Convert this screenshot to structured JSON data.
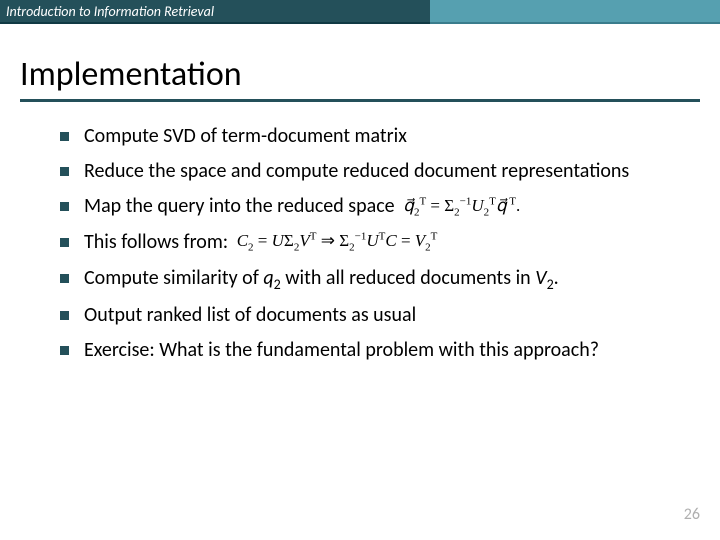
{
  "header": {
    "label": "Introduction to Information Retrieval"
  },
  "title": "Implementation",
  "bullets": [
    {
      "text": "Compute SVD of term-document matrix"
    },
    {
      "text": "Reduce the space and compute reduced document representations"
    },
    {
      "text": "Map the query into the reduced space",
      "math_suffix": "q2_formula"
    },
    {
      "text": "This follows from:",
      "math_suffix": "follows_formula"
    },
    {
      "text_html": "compute_sim"
    },
    {
      "text": "Output ranked list of documents as usual"
    },
    {
      "text": "Exercise: What is the fundamental problem with this approach?"
    }
  ],
  "math": {
    "q2_formula": "q⃗₂ᵀ = Σ₂⁻¹ U₂ᵀ q⃗ᵀ .",
    "follows_formula": "C₂ = U Σ₂ Vᵀ ⇒ Σ₂⁻¹ Uᵀ C = V₂ᵀ",
    "compute_sim_pre": "Compute similarity of ",
    "compute_sim_mid": " with all reduced documents in ",
    "compute_sim_q": "q",
    "compute_sim_q_sub": "2",
    "compute_sim_v": "V",
    "compute_sim_v_sub": "2",
    "compute_sim_end": "."
  },
  "page_number": "26"
}
